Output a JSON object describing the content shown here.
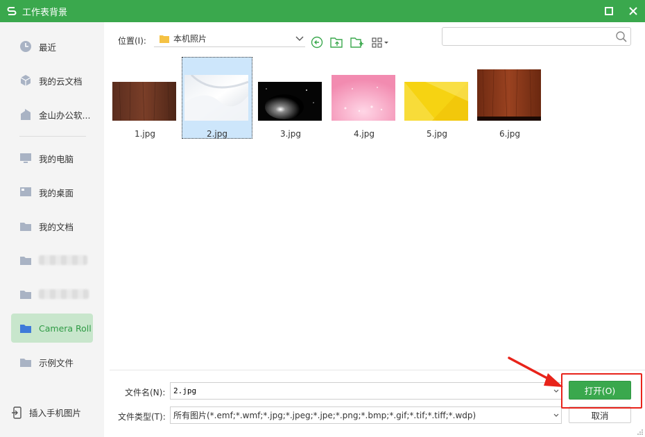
{
  "window": {
    "title": "工作表背景"
  },
  "sidebar": {
    "items": [
      {
        "label": "最近",
        "icon": "clock-icon"
      },
      {
        "label": "我的云文档",
        "icon": "cloud-cube-icon"
      },
      {
        "label": "金山办公软...",
        "icon": "building-icon"
      },
      {
        "label": "我的电脑",
        "icon": "monitor-icon"
      },
      {
        "label": "我的桌面",
        "icon": "desktop-icon"
      },
      {
        "label": "我的文档",
        "icon": "folder-icon"
      },
      {
        "label": "",
        "icon": "folder-icon"
      },
      {
        "label": "",
        "icon": "folder-icon"
      },
      {
        "label": "Camera Roll",
        "icon": "folder-icon"
      },
      {
        "label": "示例文件",
        "icon": "folder-icon"
      }
    ],
    "active_index": 8,
    "insert_phone_label": "插入手机图片"
  },
  "toolbar": {
    "location_label": "位置(I):",
    "location_value": "本机照片"
  },
  "search": {
    "placeholder": "",
    "value": ""
  },
  "files": [
    {
      "name": "1.jpg",
      "thumb": "wood-brown"
    },
    {
      "name": "2.jpg",
      "thumb": "white-silk"
    },
    {
      "name": "3.jpg",
      "thumb": "dark-nebula"
    },
    {
      "name": "4.jpg",
      "thumb": "pink-sparkle"
    },
    {
      "name": "5.jpg",
      "thumb": "yellow-geometric"
    },
    {
      "name": "6.jpg",
      "thumb": "wood-red"
    }
  ],
  "selected_file_index": 1,
  "form": {
    "filename_label": "文件名(N):",
    "filename_value": "2.jpg",
    "filetype_label": "文件类型(T):",
    "filetype_value": "所有图片(*.emf;*.wmf;*.jpg;*.jpeg;*.jpe;*.png;*.bmp;*.gif;*.tif;*.tiff;*.wdp)",
    "open_label": "打开(O)",
    "cancel_label": "取消"
  },
  "colors": {
    "brand": "#3aa84d",
    "highlight": "#e8231a",
    "selection": "#cde6fb"
  }
}
